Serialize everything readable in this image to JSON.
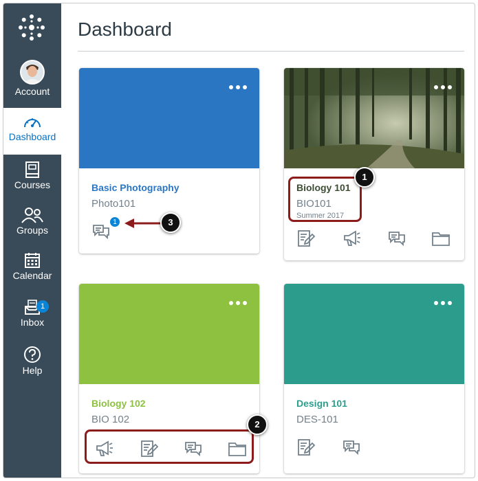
{
  "sidebar": {
    "items": [
      {
        "label": "Account"
      },
      {
        "label": "Dashboard"
      },
      {
        "label": "Courses"
      },
      {
        "label": "Groups"
      },
      {
        "label": "Calendar"
      },
      {
        "label": "Inbox",
        "badge": "1"
      },
      {
        "label": "Help"
      }
    ]
  },
  "header": {
    "title": "Dashboard"
  },
  "cards": [
    {
      "name": "Basic Photography",
      "code": "Photo101",
      "color": "#2a76c2",
      "discussion_badge": "1"
    },
    {
      "name": "Biology 101",
      "code": "BIO101",
      "term": "Summer 2017",
      "color": "#3d4d33"
    },
    {
      "name": "Biology 102",
      "code": "BIO 102",
      "color": "#8dc13f"
    },
    {
      "name": "Design 101",
      "code": "DES-101",
      "color": "#2c9d8c"
    }
  ],
  "callouts": [
    "1",
    "2",
    "3"
  ],
  "colors": {
    "sidebar": "#394b58",
    "active": "#0770c2",
    "callout": "#8c1c1c"
  }
}
